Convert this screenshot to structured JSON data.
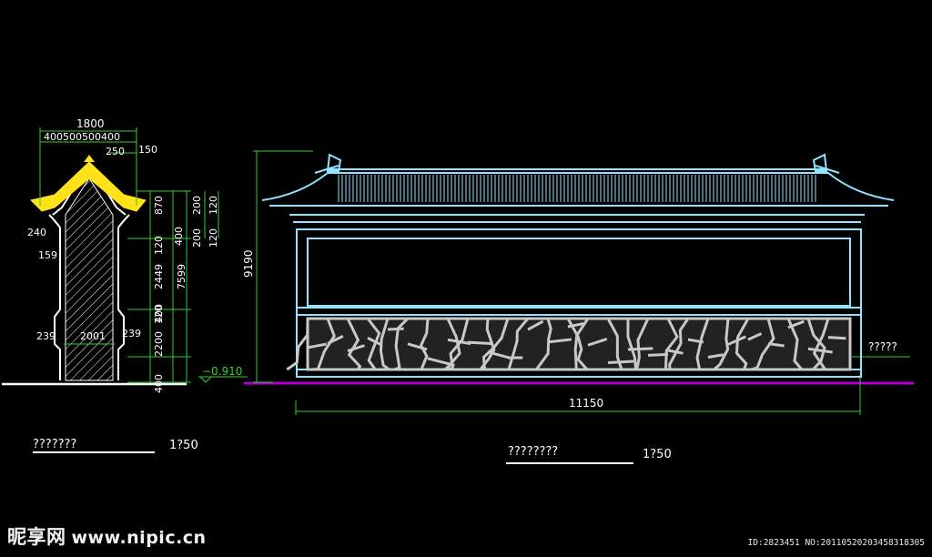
{
  "drawing": {
    "section_title": "???????",
    "section_scale": "1?50",
    "elevation_title": "????????",
    "elevation_scale": "1?50",
    "side_note": "?????",
    "level_label": "−0.910",
    "section_dims": {
      "top_width": "1800",
      "top_parts": "400500500400",
      "eave_right": "250",
      "eave_right2": "150",
      "eave_left": "240",
      "left_159": "159",
      "left_239": "239",
      "base_center": "2001",
      "base_right": "239",
      "v_870": "870",
      "v_200a": "200",
      "v_120a": "120",
      "v_200b": "200",
      "v_120b": "120",
      "v_400": "400",
      "v_120": "120",
      "v_2449": "2449",
      "v_7599": "7599",
      "v_120c": "120",
      "v_400b": "400",
      "v_2200": "2200",
      "v_400c": "400"
    },
    "elevation_dims": {
      "height": "9190",
      "width": "11150"
    }
  },
  "watermark": {
    "logo_cn": "昵享网",
    "logo_url": "www.nipic.cn",
    "id_text": "ID:2823451 NO:20110520203458318305"
  },
  "colors": {
    "background": "#000000",
    "cyan": "#8fe4ff",
    "yellow": "#ffe21a",
    "magenta": "#b000d0",
    "green": "#30d030",
    "white": "#ffffff",
    "stone": "#c8c8c8"
  }
}
